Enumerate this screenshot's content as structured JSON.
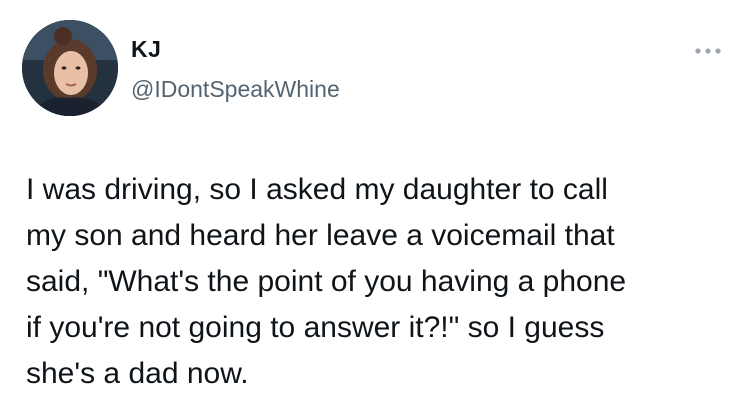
{
  "author": {
    "name": "KJ",
    "handle": "@IDontSpeakWhine"
  },
  "tweet": {
    "text": "I was driving, so I asked my daughter to call\nmy son and heard her leave a voicemail that\nsaid, \"What's the point of you having a phone\nif you're not going to answer it?!\" so I guess\nshe's a dad now."
  },
  "icons": {
    "more": "more-options-icon",
    "avatar": "profile-photo"
  },
  "colors": {
    "text": "#0f1419",
    "secondary": "#536471",
    "background": "#ffffff"
  }
}
